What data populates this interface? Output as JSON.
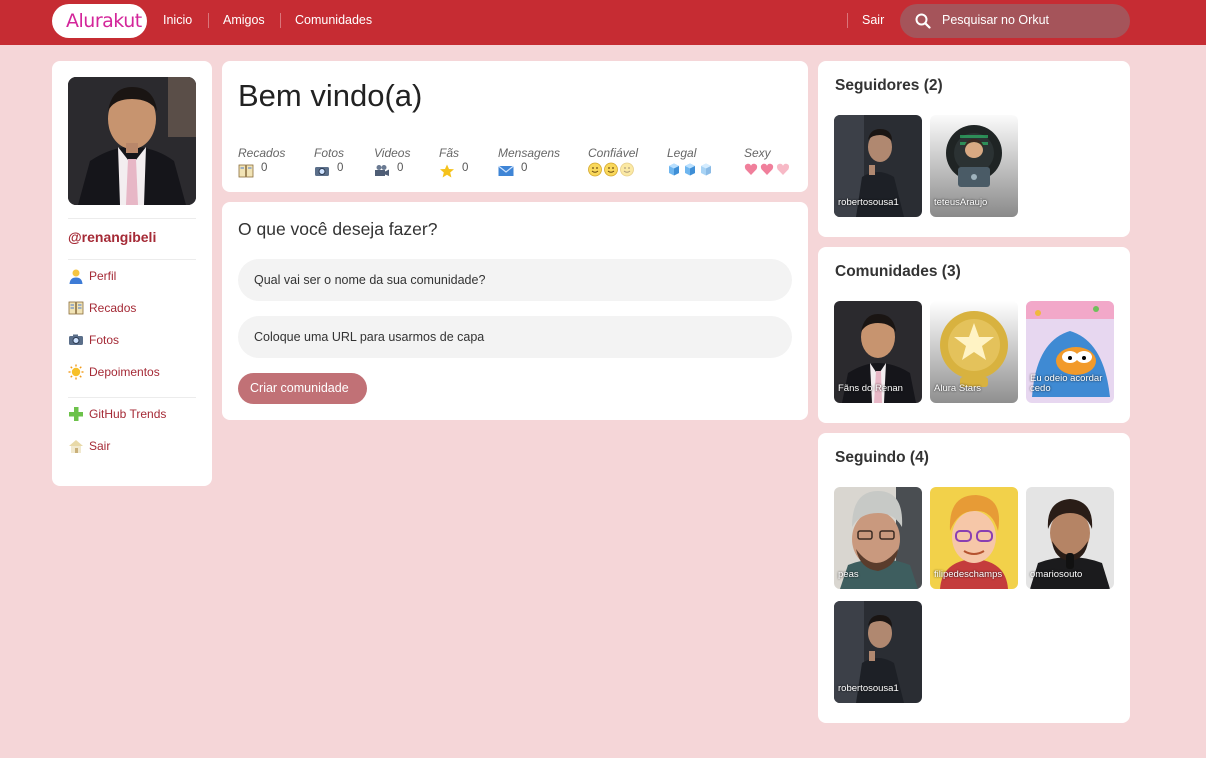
{
  "header": {
    "logo": "Alurakut",
    "nav": [
      "Inicio",
      "Amigos",
      "Comunidades"
    ],
    "logout": "Sair",
    "search_placeholder": "Pesquisar no Orkut"
  },
  "sidebar": {
    "username": "@renangibeli",
    "menu": [
      {
        "label": "Perfil",
        "icon": "user-icon"
      },
      {
        "label": "Recados",
        "icon": "book-icon"
      },
      {
        "label": "Fotos",
        "icon": "camera-icon"
      },
      {
        "label": "Depoimentos",
        "icon": "sun-icon"
      }
    ],
    "menu2": [
      {
        "label": "GitHub Trends",
        "icon": "plus-icon"
      },
      {
        "label": "Sair",
        "icon": "home-icon"
      }
    ]
  },
  "welcome": {
    "title": "Bem vindo(a)",
    "stats": [
      {
        "label": "Recados",
        "value": "0",
        "icon": "book-icon"
      },
      {
        "label": "Fotos",
        "value": "0",
        "icon": "camera-icon"
      },
      {
        "label": "Videos",
        "value": "0",
        "icon": "video-camera-icon"
      },
      {
        "label": "Fãs",
        "value": "0",
        "icon": "star-icon"
      },
      {
        "label": "Mensagens",
        "value": "0",
        "icon": "envelope-icon"
      },
      {
        "label": "Confiável",
        "icon": "smiley-icon"
      },
      {
        "label": "Legal",
        "icon": "ice-cube-icon"
      },
      {
        "label": "Sexy",
        "icon": "heart-icon"
      }
    ]
  },
  "form": {
    "title": "O que você deseja fazer?",
    "community_name_placeholder": "Qual vai ser o nome da sua comunidade?",
    "cover_url_placeholder": "Coloque uma URL para usarmos de capa",
    "submit": "Criar comunidade"
  },
  "followers": {
    "title": "Seguidores (2)",
    "items": [
      "robertosousa1",
      "teteusAraujo"
    ]
  },
  "communities": {
    "title": "Comunidades (3)",
    "items": [
      "Fãns do Renan",
      "Alura Stars",
      "Eu odeio acordar cedo"
    ]
  },
  "following": {
    "title": "Seguindo (4)",
    "items": [
      "peas",
      "filipedeschamps",
      "omariosouto",
      "robertosousa1"
    ]
  },
  "colors": {
    "header": "#c62c33",
    "background": "#f5d6d8",
    "accent": "#a52a36",
    "button": "#c17176",
    "logo": "#d3259a"
  }
}
